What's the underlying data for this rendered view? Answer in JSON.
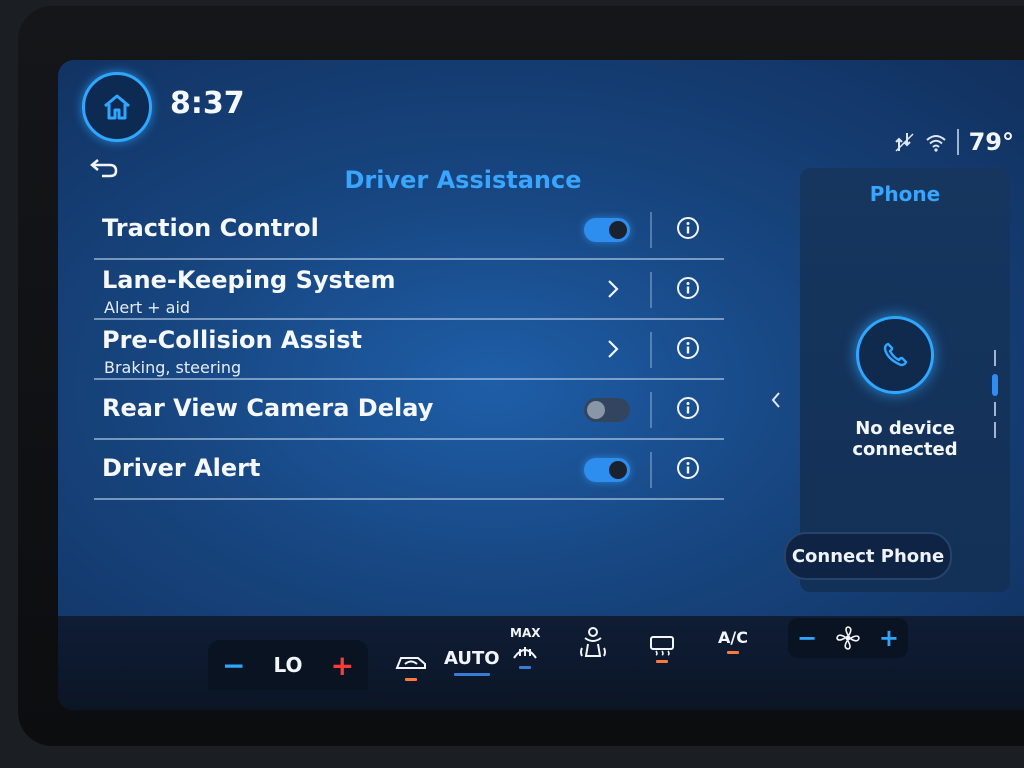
{
  "status_bar": {
    "time": "8:37",
    "temperature": "79°"
  },
  "driver_assistance": {
    "title": "Driver Assistance",
    "rows": [
      {
        "label": "Traction Control",
        "control": "toggle",
        "state": "on"
      },
      {
        "label": "Lane-Keeping System",
        "sub": "Alert + aid",
        "control": "chevron"
      },
      {
        "label": "Pre-Collision Assist",
        "sub": "Braking, steering",
        "control": "chevron"
      },
      {
        "label": "Rear View Camera Delay",
        "control": "toggle",
        "state": "off"
      },
      {
        "label": "Driver Alert",
        "control": "toggle",
        "state": "on"
      }
    ]
  },
  "phone": {
    "title": "Phone",
    "status": "No device connected",
    "connect_label": "Connect Phone"
  },
  "climate": {
    "temp_setting": "LO",
    "auto_label": "AUTO",
    "max_label": "MAX",
    "ac_label": "A/C"
  },
  "colors": {
    "accent": "#2fa6ff",
    "title_blue": "#3aa5ff",
    "heat_red": "#ff3a3a",
    "indicator_orange": "#ff7a3a"
  },
  "icons": [
    "home-icon",
    "back-arrow-icon",
    "info-icon",
    "chevron-right-icon",
    "phone-icon",
    "signal-icon",
    "wifi-icon",
    "fan-icon",
    "defrost-icon",
    "seat-icon"
  ]
}
